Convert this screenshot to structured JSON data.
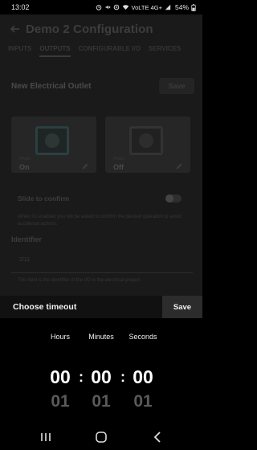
{
  "status_bar": {
    "time": "13:02",
    "network": "VoLTE 4G+",
    "battery": "54%",
    "icons": [
      "alarm-icon",
      "mute-icon",
      "data-saver-icon",
      "wifi-icon",
      "signal-icon",
      "battery-icon"
    ]
  },
  "header": {
    "title": "Demo 2 Configuration",
    "back_icon": "back-arrow-icon"
  },
  "tabs": [
    {
      "label": "INPUTS",
      "active": false
    },
    {
      "label": "OUTPUTS",
      "active": true
    },
    {
      "label": "CONFIGURABLE I/O",
      "active": false
    },
    {
      "label": "SERVICES",
      "active": false
    }
  ],
  "form": {
    "title": "New Electrical Outlet",
    "save_label": "Save",
    "photo_on": {
      "caption": "Photo",
      "value": "On"
    },
    "photo_off": {
      "caption": "Photo",
      "value": "Off"
    },
    "slide_to_confirm": {
      "label": "Slide to confirm",
      "enabled": false,
      "description": "When it's enabled you will be asked to confirm the desired operation to avoid accidental actions."
    },
    "identifier": {
      "label": "Identifier",
      "value": "2/11",
      "help": "This field is the identifier of the I/O in the electrical project"
    }
  },
  "timeout_sheet": {
    "title": "Choose timeout",
    "save_label": "Save",
    "columns": [
      {
        "label": "Hours",
        "value": "00",
        "next": "01"
      },
      {
        "label": "Minutes",
        "value": "00",
        "next": "01"
      },
      {
        "label": "Seconds",
        "value": "00",
        "next": "01"
      }
    ],
    "separator": ":"
  },
  "colors": {
    "background": "#000000",
    "sheet_header": "#111111",
    "save_button": "#2c2c2c",
    "dimmed_text": "#3d3d3d",
    "picker_next": "#5a5a5a"
  }
}
